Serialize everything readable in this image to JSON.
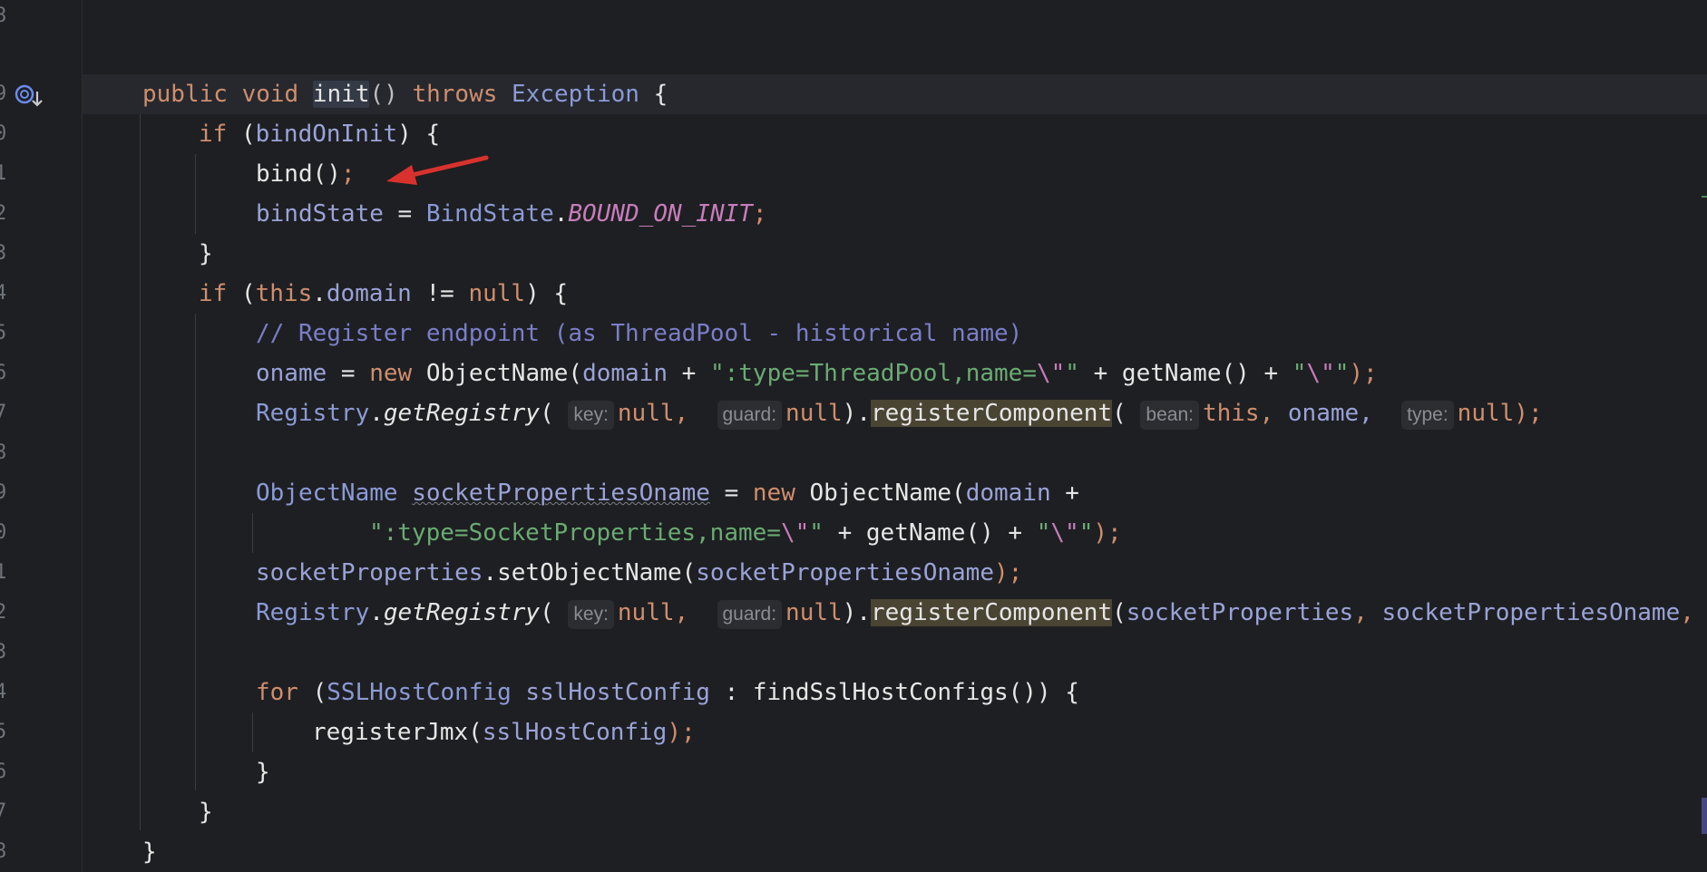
{
  "gutter": {
    "line_numbers": [
      "8",
      "9",
      "0",
      "1",
      "2",
      "3",
      "4",
      "5",
      "6",
      "7",
      "8",
      "9",
      "0",
      "1",
      "2",
      "3",
      "4",
      "5",
      "6",
      "7",
      "8"
    ],
    "marker_icon": "override-down-icon"
  },
  "code": {
    "l1": {
      "mod": "public",
      "void": "void",
      "name": "init",
      "parens": "()",
      "throws": "throws",
      "exc": "Exception",
      "brace": " {"
    },
    "l2": {
      "if": "if",
      "open": " (",
      "cond": "bindOnInit",
      "close": ") {"
    },
    "l3": {
      "call": "bind()",
      "semi": ";"
    },
    "l4": {
      "var": "bindState",
      "eq": " = ",
      "cls": "BindState",
      "dot": ".",
      "const": "BOUND_ON_INIT",
      "semi": ";"
    },
    "l5": {
      "brace": "}"
    },
    "l6": {
      "if": "if",
      "open": " (",
      "this": "this",
      "dot": ".",
      "field": "domain",
      "ne": " != ",
      "null": "null",
      "close": ") {"
    },
    "l7": {
      "comment": "// Register endpoint (as ThreadPool - historical name)"
    },
    "l8": {
      "var": "oname",
      "eq": " = ",
      "new": "new",
      "cls": " ObjectName(",
      "field": "domain",
      "plus1": " + ",
      "s1a": "\":type=ThreadPool,name=",
      "s1b": "\\\"",
      "s1c": "\"",
      "plus2": " + getName() + ",
      "s2a": "\"",
      "s2b": "\\\"",
      "s2c": "\"",
      "end": ");"
    },
    "l9": {
      "reg": "Registry",
      "dot": ".",
      "get": "getRegistry",
      "open": "(",
      "hint_key": "key:",
      "null1": "null,",
      "hint_guard": "guard:",
      "null2": "null",
      "close": ").",
      "method": "registerComponent",
      "open2": "(",
      "hint_bean": "bean:",
      "this": "this,",
      "oname": " oname,",
      "hint_type": "type:",
      "null3": "null",
      "end": ");"
    },
    "l11": {
      "cls": "ObjectName",
      "var": "socketPropertiesOname",
      "eq": " = ",
      "new": "new",
      "cls2": " ObjectName(",
      "field": "domain",
      "plus": " +"
    },
    "l12": {
      "s1a": "\":type=SocketProperties,name=",
      "s1b": "\\\"",
      "s1c": "\"",
      "plus": " + getName() + ",
      "s2a": "\"",
      "s2b": "\\\"",
      "s2c": "\"",
      "end": ");"
    },
    "l13": {
      "field": "socketProperties",
      "call": ".setObjectName(",
      "arg": "socketPropertiesOname",
      "end": ");"
    },
    "l14": {
      "reg": "Registry",
      "dot": ".",
      "get": "getRegistry",
      "open": "(",
      "hint_key": "key:",
      "null1": "null,",
      "hint_guard": "guard:",
      "null2": "null",
      "close": ").",
      "method": "registerComponent",
      "open2": "(",
      "arg1": "socketProperties",
      "comma": ", ",
      "arg2": "socketPropertiesOname",
      "comma2": ","
    },
    "l16": {
      "for": "for",
      "open": " (",
      "cls": "SSLHostConfig",
      "var": " sslHostConfig",
      "colon": " : findSslHostConfigs()) {"
    },
    "l17": {
      "call": "registerJmx(",
      "arg": "sslHostConfig",
      "end": ");"
    },
    "l18": {
      "brace": "}"
    },
    "l19": {
      "brace": "}"
    },
    "l20": {
      "brace": "}"
    }
  },
  "colors": {
    "background": "#1e1f22",
    "keyword": "#cf8e6d",
    "string": "#6aab73",
    "comment": "#7a7ec8",
    "field": "#9aa3d8",
    "arrow": "#d9322e"
  }
}
